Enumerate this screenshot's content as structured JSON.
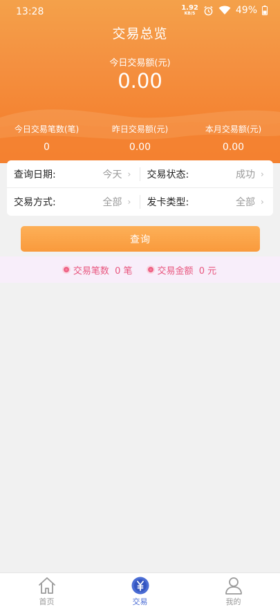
{
  "status_bar": {
    "time": "13:28",
    "net_speed": "1.92",
    "net_unit": "KB/S",
    "battery": "49%"
  },
  "header": {
    "title": "交易总览",
    "today_amount_label": "今日交易额(元)",
    "today_amount_value": "0.00",
    "stats": [
      {
        "label": "今日交易笔数(笔)",
        "value": "0"
      },
      {
        "label": "昨日交易额(元)",
        "value": "0.00"
      },
      {
        "label": "本月交易额(元)",
        "value": "0.00"
      }
    ]
  },
  "filters": {
    "date": {
      "label": "查询日期:",
      "value": "今天"
    },
    "status": {
      "label": "交易状态:",
      "value": "成功"
    },
    "method": {
      "label": "交易方式:",
      "value": "全部"
    },
    "card_type": {
      "label": "发卡类型:",
      "value": "全部"
    }
  },
  "query_button": "查询",
  "summary": {
    "count": "交易笔数  0 笔",
    "amount": "交易金额  0 元"
  },
  "nav": [
    {
      "label": "首页",
      "icon": "home-icon"
    },
    {
      "label": "交易",
      "icon": "yuan-icon"
    },
    {
      "label": "我的",
      "icon": "user-icon"
    }
  ],
  "colors": {
    "header_top": "#f4a14a",
    "header_bottom": "#f47a26",
    "button": "#f99a3c",
    "summary_text": "#e8567e",
    "nav_active": "#4a6cd4"
  }
}
